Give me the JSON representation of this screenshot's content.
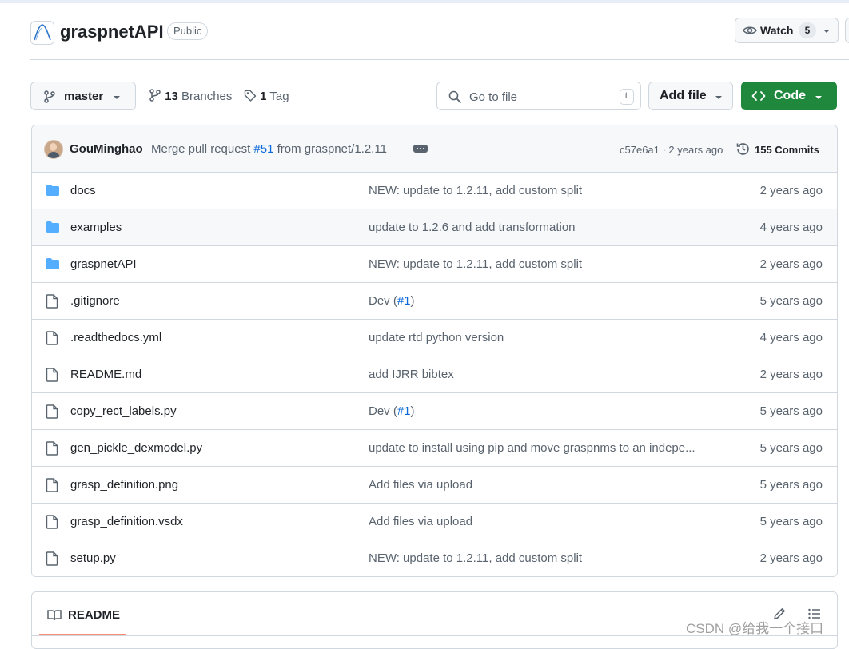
{
  "repo": {
    "name": "graspnetAPI",
    "visibility": "Public",
    "watch_label": "Watch",
    "watch_count": "5"
  },
  "toolbar": {
    "branch": "master",
    "branches_count": "13",
    "branches_label": "Branches",
    "tags_count": "1",
    "tags_label": "Tag",
    "goto_placeholder": "Go to file",
    "goto_key": "t",
    "add_file_label": "Add file",
    "code_label": "Code"
  },
  "commit": {
    "author": "GouMinghao",
    "message_prefix": "Merge pull request",
    "pr": "#51",
    "message_suffix": "from graspnet/1.2.11",
    "sha_time": "c57e6a1 · 2 years ago",
    "commits_label": "155 Commits"
  },
  "files": [
    {
      "name": "docs",
      "type": "folder",
      "msg": "NEW: update to 1.2.11, add custom split",
      "age": "2 years ago"
    },
    {
      "name": "examples",
      "type": "folder",
      "msg": "update to 1.2.6 and add transformation",
      "age": "4 years ago"
    },
    {
      "name": "graspnetAPI",
      "type": "folder",
      "msg": "NEW: update to 1.2.11, add custom split",
      "age": "2 years ago"
    },
    {
      "name": ".gitignore",
      "type": "file",
      "msg_prefix": "Dev (",
      "msg_link": "#1",
      "msg_suffix": ")",
      "age": "5 years ago"
    },
    {
      "name": ".readthedocs.yml",
      "type": "file",
      "msg": "update rtd python version",
      "age": "4 years ago"
    },
    {
      "name": "README.md",
      "type": "file",
      "msg": "add IJRR bibtex",
      "age": "2 years ago"
    },
    {
      "name": "copy_rect_labels.py",
      "type": "file",
      "msg_prefix": "Dev (",
      "msg_link": "#1",
      "msg_suffix": ")",
      "age": "5 years ago"
    },
    {
      "name": "gen_pickle_dexmodel.py",
      "type": "file",
      "msg": "update to install using pip and move graspnms to an indepe...",
      "age": "5 years ago"
    },
    {
      "name": "grasp_definition.png",
      "type": "file",
      "msg": "Add files via upload",
      "age": "5 years ago"
    },
    {
      "name": "grasp_definition.vsdx",
      "type": "file",
      "msg": "Add files via upload",
      "age": "5 years ago"
    },
    {
      "name": "setup.py",
      "type": "file",
      "msg": "NEW: update to 1.2.11, add custom split",
      "age": "2 years ago"
    }
  ],
  "readme": {
    "label": "README"
  },
  "watermark": "CSDN @给我一个接口",
  "colors": {
    "accent_link": "#0969da",
    "code_button": "#1f883d",
    "folder_icon": "#54aeff",
    "readme_underline": "#fd8c73"
  },
  "icons": {
    "folder": "folder-icon",
    "file": "file-icon",
    "branch": "git-branch-icon",
    "tag": "tag-icon",
    "search": "search-icon",
    "history": "history-icon",
    "book": "book-icon",
    "pencil": "pencil-icon",
    "list": "list-unordered-icon",
    "eye": "eye-icon"
  }
}
